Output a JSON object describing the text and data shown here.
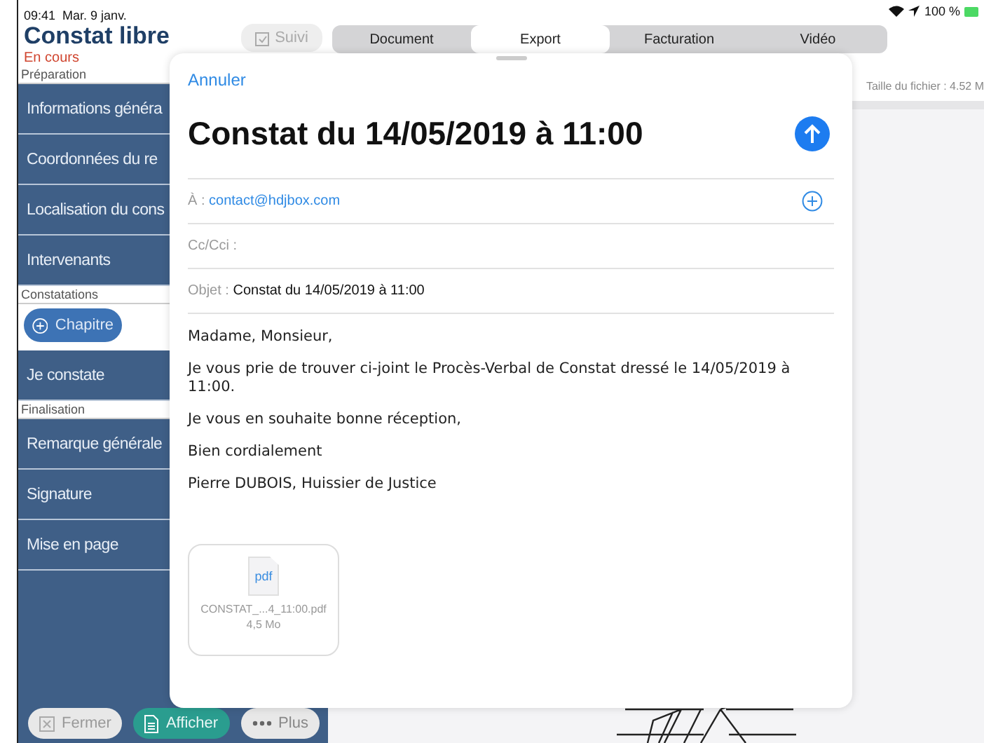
{
  "status_bar": {
    "time": "09:41",
    "date": "Mar. 9 janv.",
    "battery": "100 %"
  },
  "sidebar": {
    "title": "Constat libre",
    "status": "En cours",
    "suivi_button": "Suivi",
    "sections": [
      {
        "label": "Préparation",
        "items": [
          {
            "label": "Informations généra",
            "selected": false
          },
          {
            "label": "Coordonnées du re",
            "selected": false
          },
          {
            "label": "Localisation du cons",
            "selected": false
          },
          {
            "label": "Intervenants",
            "selected": false
          }
        ]
      },
      {
        "label": "Constatations",
        "add_button": "Chapitre",
        "items": [
          {
            "label": "Je constate",
            "selected": false
          }
        ]
      },
      {
        "label": "Finalisation",
        "items": [
          {
            "label": "Remarque générale",
            "selected": false
          },
          {
            "label": "Signature",
            "selected": false
          },
          {
            "label": "Mise en page",
            "selected": false
          }
        ]
      }
    ],
    "bottom_buttons": [
      {
        "label": "Fermer",
        "kind": "close"
      },
      {
        "label": "Afficher",
        "kind": "show"
      },
      {
        "label": "Plus",
        "kind": "more"
      }
    ]
  },
  "tabs": [
    {
      "label": "Document",
      "selected": false
    },
    {
      "label": "Export",
      "selected": true
    },
    {
      "label": "Facturation",
      "selected": false
    },
    {
      "label": "Vidéo",
      "selected": false
    }
  ],
  "file_size": "Taille du fichier : 4.52 M",
  "mail": {
    "cancel": "Annuler",
    "title": "Constat du 14/05/2019 à 11:00",
    "to_label": "À :",
    "to": "contact@hdjbox.com",
    "cc_label": "Cc/Cci :",
    "subject_label": "Objet :",
    "subject": "Constat du 14/05/2019 à 11:00",
    "body": [
      "Madame, Monsieur,",
      "Je vous prie de trouver ci-joint le Procès-Verbal de Constat dressé le 14/05/2019 à 11:00.",
      "Je vous en souhaite bonne réception,",
      "Bien cordialement",
      "Pierre DUBOIS, Huissier de Justice"
    ],
    "attachment": {
      "type_label": "pdf",
      "name": "CONSTAT_...4_11:00.pdf",
      "size": "4,5 Mo"
    }
  }
}
